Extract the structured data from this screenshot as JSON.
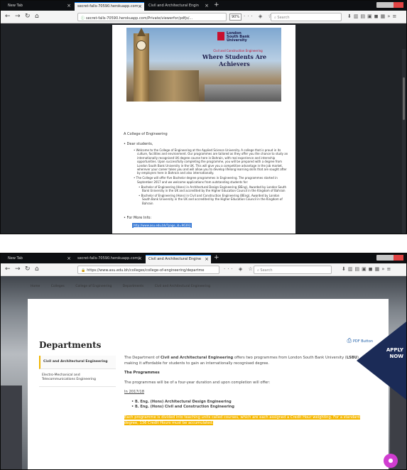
{
  "colors": {
    "accent": "#0a84ff",
    "highlight": "#f5b700",
    "apply_bg": "#1b2b57",
    "chat": "#d03dd0"
  },
  "window1": {
    "tabs": [
      {
        "label": "New Tab",
        "active": false
      },
      {
        "label": "secret-falls-70590.herokuapp.com",
        "active": true
      },
      {
        "label": "Civil and Architectural Engin",
        "active": false
      }
    ],
    "url": "secret-falls-70590.herokuapp.com/Private/viewerfor/pdfjs/...",
    "zoom": "90%",
    "search_placeholder": "Search",
    "pdf": {
      "logo_line1": "London",
      "logo_line2": "South Bank",
      "logo_line3": "University",
      "hero_sub": "Civil and Construction Engineering",
      "hero_tagline": "Where Students Are Achievers",
      "college": "A College of Engineering",
      "dear": "Dear students,",
      "bullets": [
        {
          "text": "Welcome to the College of Engineering at the Applied Science University. A college that is proud in its culture, facilities and environment. Our programmes are tailored as they offer you the chance to study an internationally recognised UK degree course here in Bahrain, with real experience and internship opportunities. Upon successfully completing the programme, you will be prepared with a degree from London South Bank University in the UK. This will give you a competitive advantage in the job market, wherever your career takes you and will allow you to develop lifelong learning skills that are sought after by employers here in Bahrain and also internationally.",
          "sub": false
        },
        {
          "text": "The College will offer five Bachelor degree programmes in Engineering. The programmes started in September 2017 and we welcome applications from outstanding students for:",
          "sub": false
        },
        {
          "text": "Bachelor of Engineering (Hons) in Architectural Design Engineering (BEng), Awarded by London South Bank University in the UK and accredited by the Higher Education Council in the Kingdom of Bahrain",
          "sub": true
        },
        {
          "text": "Bachelor of Engineering (Hons) in Civil and Construction Engineering (BEng), Awarded by London South Bank University in the UK and accredited by the Higher Education Council in the Kingdom of Bahrain",
          "sub": true
        }
      ],
      "more_info": "For More Info:",
      "link": "http://www.asu.edu.bh/?page_id=96393"
    }
  },
  "window2": {
    "tabs": [
      {
        "label": "New Tab",
        "active": false
      },
      {
        "label": "secret-falls-70590.herokuapp.com/",
        "active": false
      },
      {
        "label": "Civil and Architectural Engine",
        "active": true
      }
    ],
    "url": "https://www.asu.edu.bh/colleges/college-of-engineering/departme",
    "search_placeholder": "Search",
    "breadcrumb": [
      "Home",
      "Colleges",
      "College of Engineering",
      "Departments",
      "Civil and Architectural Engineering"
    ],
    "page_title": "Departments",
    "pdf_button": "PDF Button",
    "side_nav": [
      {
        "label": "Civil and Architectural Engineering",
        "active": true
      },
      {
        "label": "Electro-Mechanical and Telecommunications Engineering",
        "active": false
      }
    ],
    "content": {
      "intro_a": "The Department of ",
      "intro_b": "Civil and Architectural Engineering",
      "intro_c": " offers two programmes from London South Bank University (",
      "intro_d": "LSBU",
      "intro_e": ") making it affordable for students to gain an internationally recognised degree.",
      "heading": "The Programmes",
      "duration": "The programmes will be of a four-year duration and upon completion will offer:",
      "year": "In 2017/18",
      "programmes": [
        "B. Eng. (Hons) Architectural Design Engineering",
        "B. Eng. (Hons) Civil and Construction Engineering"
      ],
      "highlight": "Each programme is divided into teaching units called courses, which are each assigned a Credit Hour weighting. For a standard degree, 136 Credit Hours must be accumulated."
    },
    "apply_line1": "APPLY",
    "apply_line2": "NOW"
  }
}
